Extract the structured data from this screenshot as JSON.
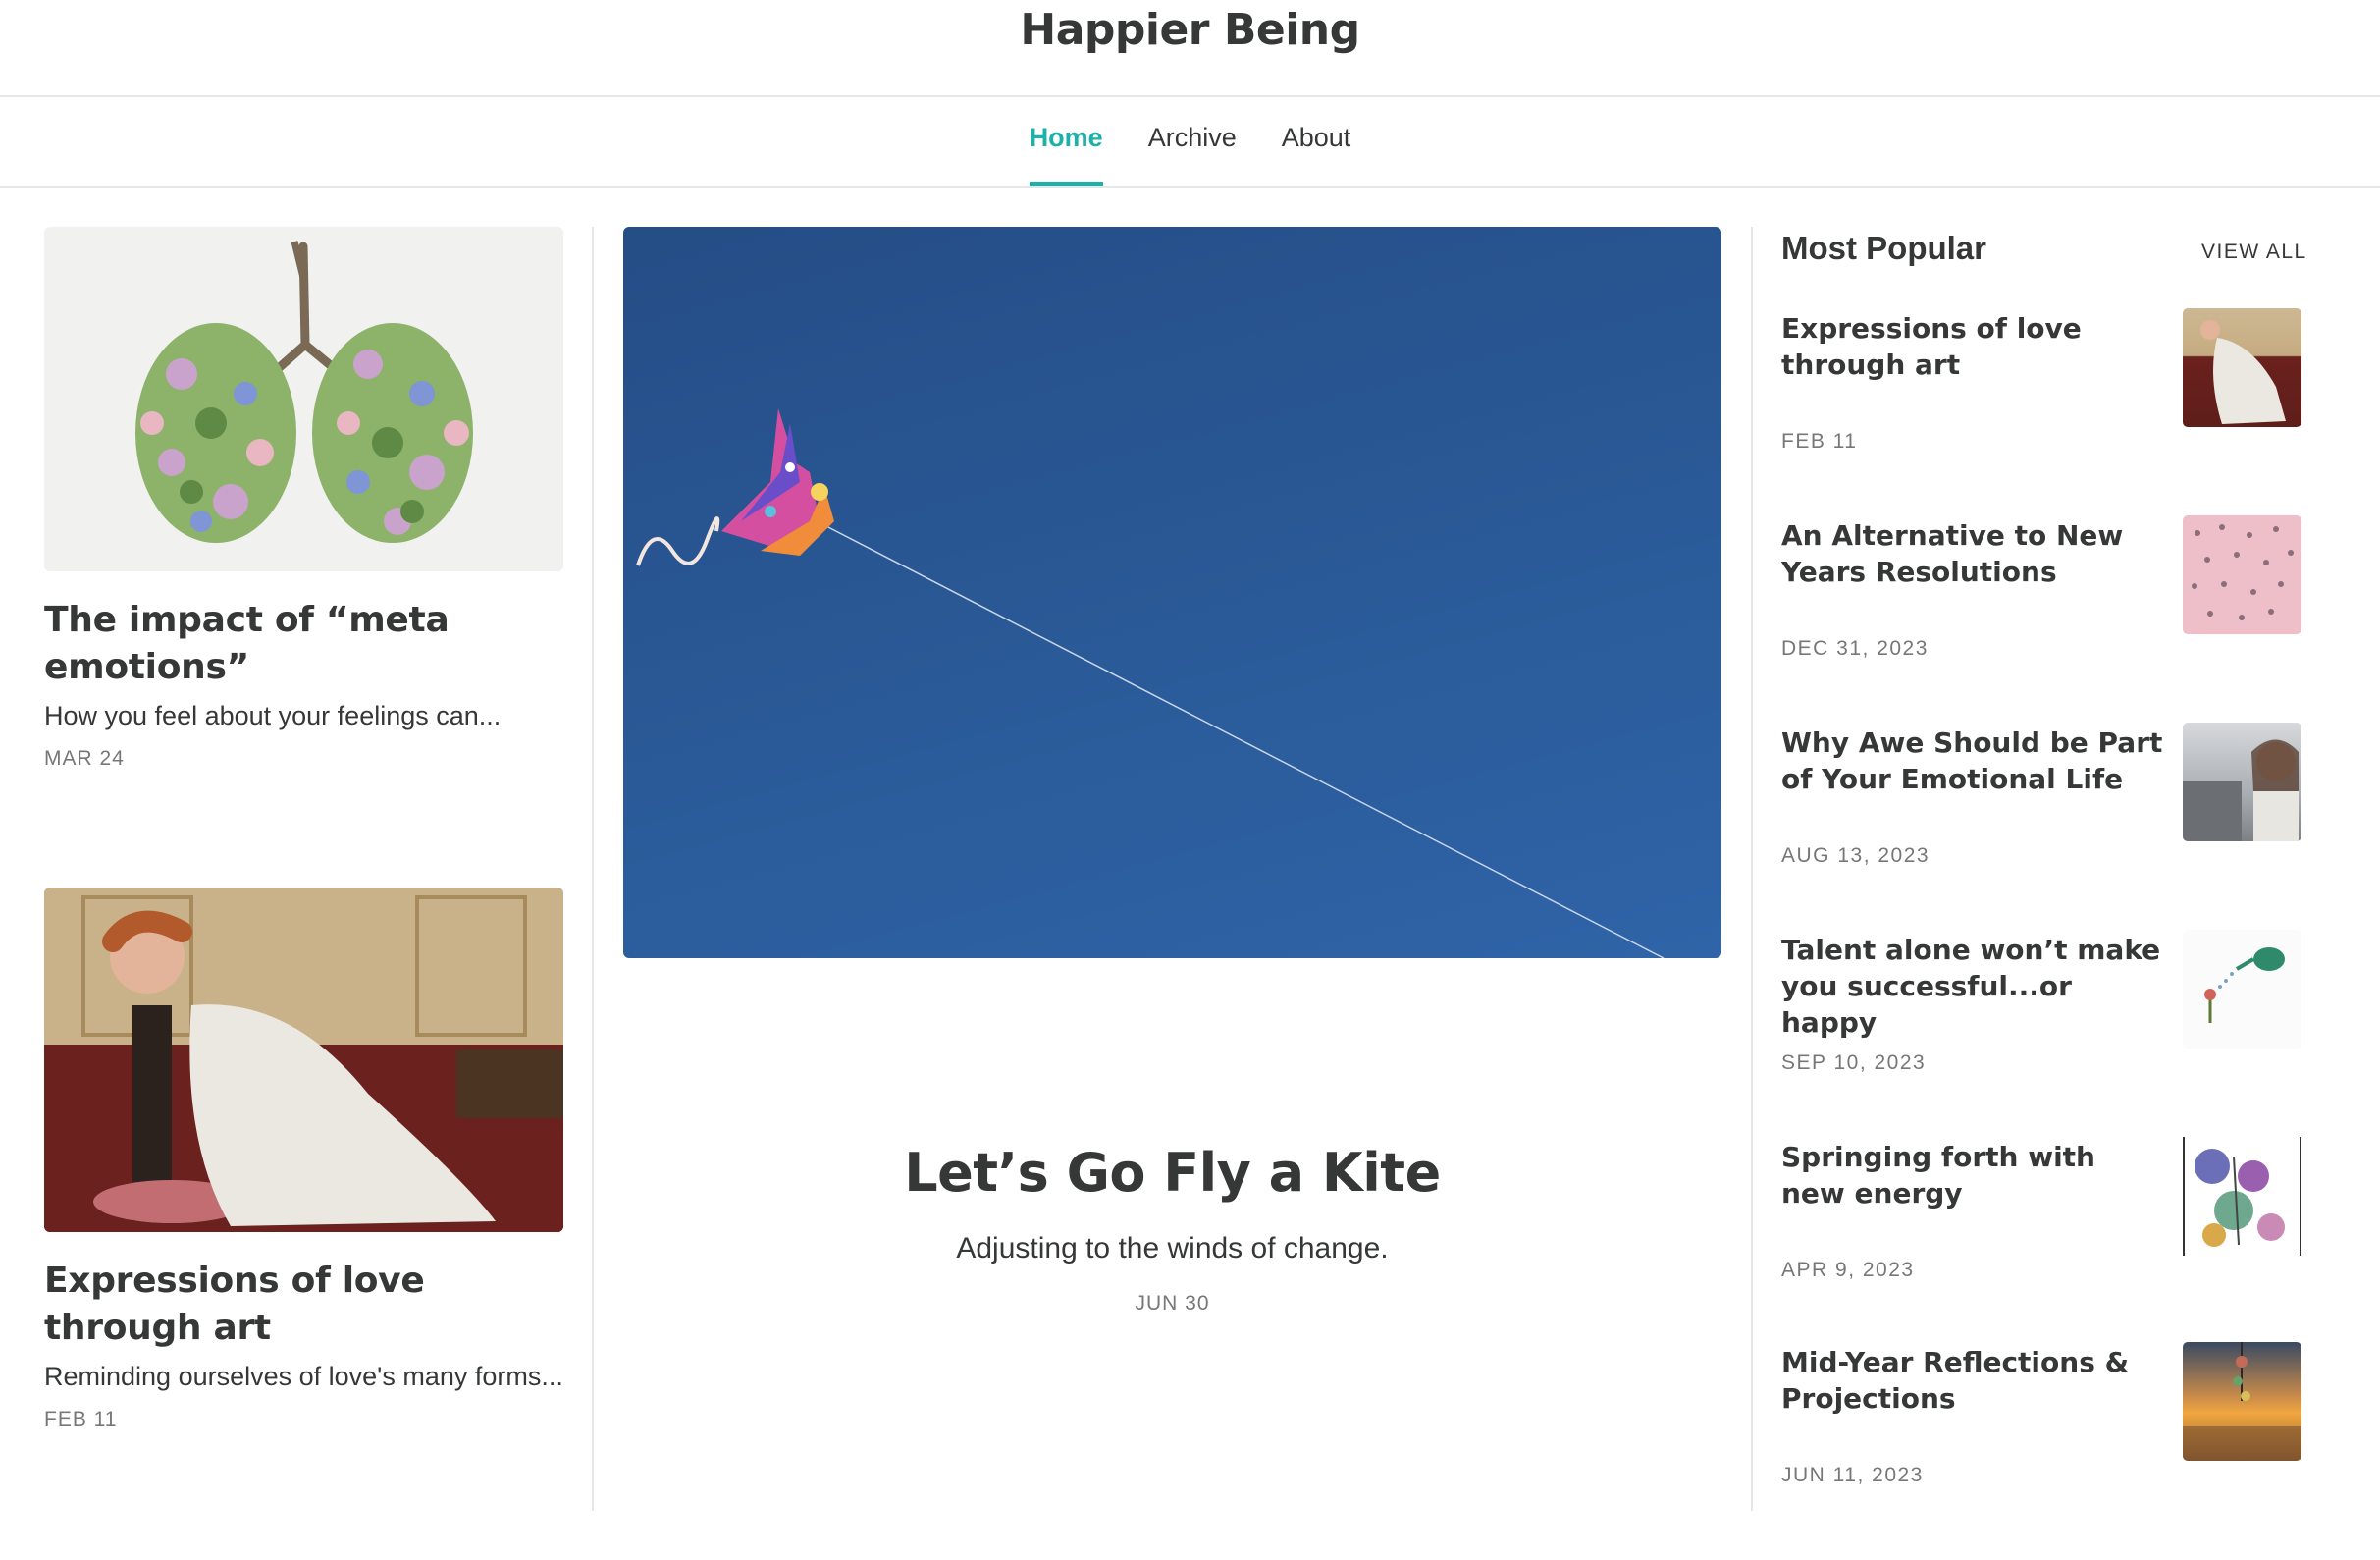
{
  "site": {
    "title": "Happier Being"
  },
  "nav": {
    "items": [
      {
        "label": "Home",
        "active": true
      },
      {
        "label": "Archive"
      },
      {
        "label": "About"
      }
    ]
  },
  "left_posts": [
    {
      "title": "The impact of “meta emotions”",
      "subtitle": "How you feel about your feelings can...",
      "date": "MAR 24"
    },
    {
      "title": "Expressions of love through art",
      "subtitle": "Reminding ourselves of love's many forms...",
      "date": "FEB 11"
    }
  ],
  "featured": {
    "title": "Let’s Go Fly a Kite",
    "subtitle": "Adjusting to the winds of change.",
    "date": "JUN 30"
  },
  "popular": {
    "heading": "Most Popular",
    "view_all": "VIEW ALL",
    "items": [
      {
        "title": "Expressions of love through art",
        "date": "FEB 11"
      },
      {
        "title": "An Alternative to New Years Resolutions",
        "date": "DEC 31, 2023"
      },
      {
        "title": "Why Awe Should be Part of Your Emotional Life",
        "date": "AUG 13, 2023"
      },
      {
        "title": "Talent alone won’t make you successful...or happy",
        "date": "SEP 10, 2023"
      },
      {
        "title": "Springing forth with new energy",
        "date": "APR 9, 2023"
      },
      {
        "title": "Mid-Year Reflections & Projections",
        "date": "JUN 11, 2023"
      }
    ]
  },
  "colors": {
    "accent": "#1cb2a9",
    "text": "#363737",
    "muted": "#777777",
    "hero_sky": "#2a5a98"
  }
}
